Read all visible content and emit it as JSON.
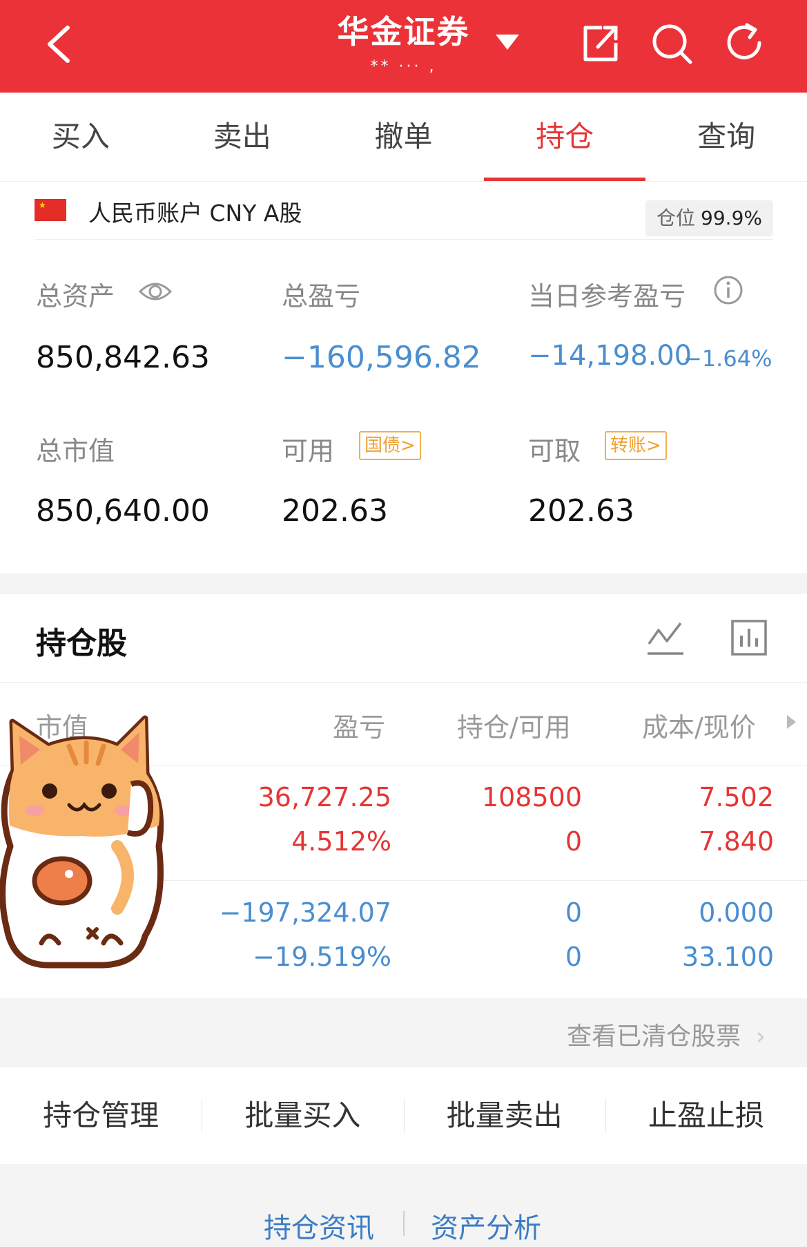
{
  "header": {
    "title": "华金证券",
    "account_masked": "** ··· ,",
    "icons": [
      "back-icon",
      "share-icon",
      "search-icon",
      "refresh-icon"
    ]
  },
  "tabs": [
    {
      "label": "买入",
      "active": false
    },
    {
      "label": "卖出",
      "active": false
    },
    {
      "label": "撤单",
      "active": false
    },
    {
      "label": "持仓",
      "active": true
    },
    {
      "label": "查询",
      "active": false
    }
  ],
  "account": {
    "label": "人民币账户 CNY A股",
    "position_label": "仓位",
    "position_value": "99.9%"
  },
  "metrics": {
    "total_assets_label": "总资产",
    "total_assets": "850,842.63",
    "total_pnl_label": "总盈亏",
    "total_pnl": "−160,596.82",
    "daily_pnl_label": "当日参考盈亏",
    "daily_pnl": "−14,198.00",
    "daily_pnl_pct": "−1.64%",
    "market_value_label": "总市值",
    "market_value": "850,640.00",
    "available_label": "可用",
    "available_tag": "国债>",
    "available": "202.63",
    "withdrawable_label": "可取",
    "withdrawable_tag": "转账>",
    "withdrawable": "202.63"
  },
  "holdings": {
    "title": "持仓股",
    "columns": [
      "市值",
      "盈亏",
      "持仓/可用",
      "成本/现价"
    ],
    "rows": [
      {
        "pnl": "36,727.25",
        "pnl_pct": "4.512%",
        "position": "108500",
        "available": "0",
        "cost": "7.502",
        "price": "7.840",
        "color": "red"
      },
      {
        "pnl": "−197,324.07",
        "pnl_pct": "−19.519%",
        "position": "0",
        "available": "0",
        "cost": "0.000",
        "price": "33.100",
        "color": "blue"
      }
    ],
    "view_cleared": "查看已清仓股票"
  },
  "actions": [
    "持仓管理",
    "批量买入",
    "批量卖出",
    "止盈止损"
  ],
  "bottom_links": [
    "持仓资讯",
    "资产分析"
  ],
  "colors": {
    "brand_red": "#ea3238",
    "loss_blue": "#4a8ed0",
    "tag_orange": "#f0a030"
  }
}
